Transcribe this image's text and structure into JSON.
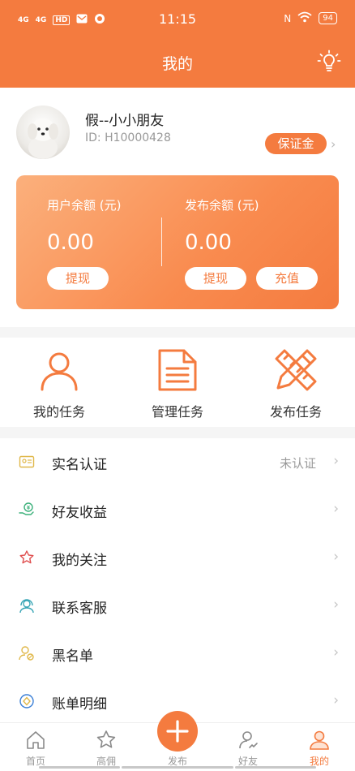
{
  "status_bar": {
    "sim1": "4G",
    "sim2": "4G",
    "hd": "HD",
    "time": "11:15",
    "nfc": "N",
    "battery": "94"
  },
  "header": {
    "title": "我的",
    "bulb_icon": "lightbulb-icon"
  },
  "profile": {
    "username": "假--小小朋友",
    "user_id": "ID: H10000428",
    "deposit_label": "保证金"
  },
  "balance": {
    "user_label": "用户余额 (元)",
    "user_value": "0.00",
    "withdraw_label": "提现",
    "publish_label": "发布余额 (元)",
    "publish_value": "0.00",
    "withdraw2_label": "提现",
    "recharge_label": "充值"
  },
  "actions": [
    {
      "label": "我的任务",
      "icon": "person-icon"
    },
    {
      "label": "管理任务",
      "icon": "document-icon"
    },
    {
      "label": "发布任务",
      "icon": "pencil-ruler-icon"
    }
  ],
  "menu": [
    {
      "label": "实名认证",
      "value": "未认证",
      "icon": "id-card-icon"
    },
    {
      "label": "好友收益",
      "value": "",
      "icon": "hand-money-icon"
    },
    {
      "label": "我的关注",
      "value": "",
      "icon": "star-icon"
    },
    {
      "label": "联系客服",
      "value": "",
      "icon": "headset-icon"
    },
    {
      "label": "黑名单",
      "value": "",
      "icon": "user-block-icon"
    },
    {
      "label": "账单明细",
      "value": "",
      "icon": "bill-icon"
    }
  ],
  "tabs": [
    {
      "label": "首页",
      "icon": "home-icon"
    },
    {
      "label": "高佣",
      "icon": "star-icon"
    },
    {
      "label": "发布",
      "icon": "plus-icon"
    },
    {
      "label": "好友",
      "icon": "friend-icon"
    },
    {
      "label": "我的",
      "icon": "person-icon"
    }
  ],
  "colors": {
    "accent": "#f47b3f",
    "card_start": "#fbb07c",
    "card_end": "#f47b3f"
  }
}
